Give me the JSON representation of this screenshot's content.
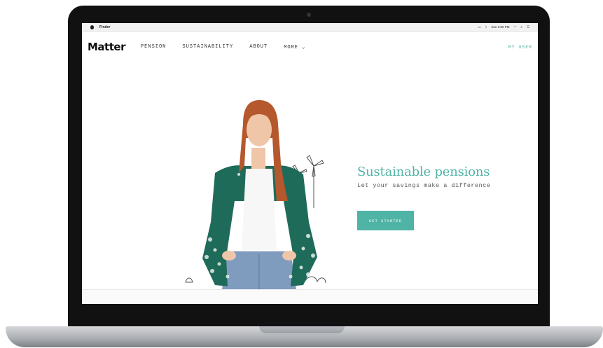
{
  "menubar": {
    "app_name": "Finder",
    "clock": "Sun 3:00 PM"
  },
  "site": {
    "logo": "Matter",
    "nav": [
      {
        "label": "PENSION"
      },
      {
        "label": "SUSTAINABILITY"
      },
      {
        "label": "ABOUT"
      },
      {
        "label": "MORE ⌄"
      }
    ],
    "login": "MY USER"
  },
  "hero": {
    "title": "Sustainable pensions",
    "subtitle": "Let your savings make a difference",
    "cta": "GET STARTED"
  },
  "colors": {
    "accent": "#4fb3a6",
    "jacket": "#1f6b5a",
    "hair": "#b5582e",
    "jeans": "#7f9bbd"
  },
  "icons": [
    "apple-icon",
    "wifi-icon",
    "search-icon",
    "menu-icon",
    "windmill-icon"
  ]
}
